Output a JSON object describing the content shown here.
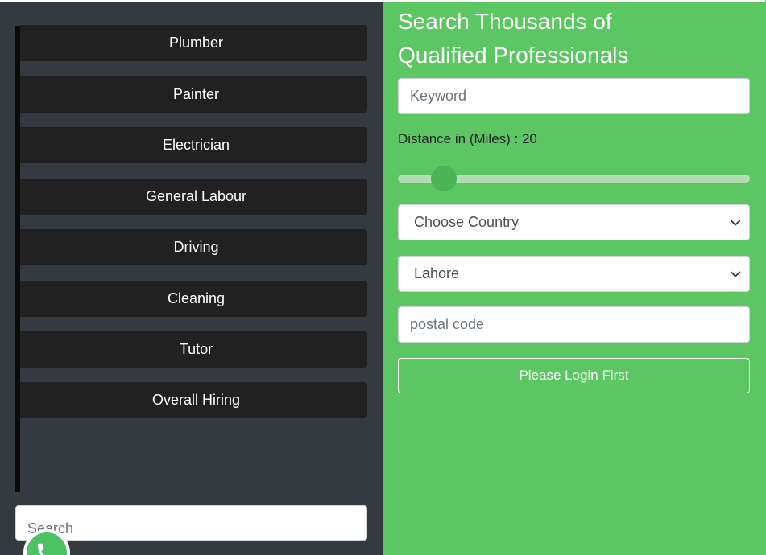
{
  "sidebar": {
    "categories": [
      {
        "label": "Plumber"
      },
      {
        "label": "Painter"
      },
      {
        "label": "Electrician"
      },
      {
        "label": "General Labour"
      },
      {
        "label": "Driving"
      },
      {
        "label": "Cleaning"
      },
      {
        "label": "Tutor"
      },
      {
        "label": "Overall Hiring"
      }
    ],
    "search_placeholder": "Search"
  },
  "search_panel": {
    "heading_line1": "Search Thousands of",
    "heading_line2": "Qualified Professionals",
    "keyword_placeholder": "Keyword",
    "distance_label": "Distance in (Miles) : 20",
    "distance_value": 20,
    "country_select": "Choose Country",
    "city_select": "Lahore",
    "postal_placeholder": "postal code",
    "login_button": "Please Login First"
  },
  "icons": {
    "whatsapp": "whatsapp-icon",
    "chevron": "chevron-down-icon"
  },
  "colors": {
    "panel_dark": "#343a40",
    "button_dark": "#212121",
    "accent_green": "#5cc663",
    "whatsapp_green": "#4cc262"
  }
}
